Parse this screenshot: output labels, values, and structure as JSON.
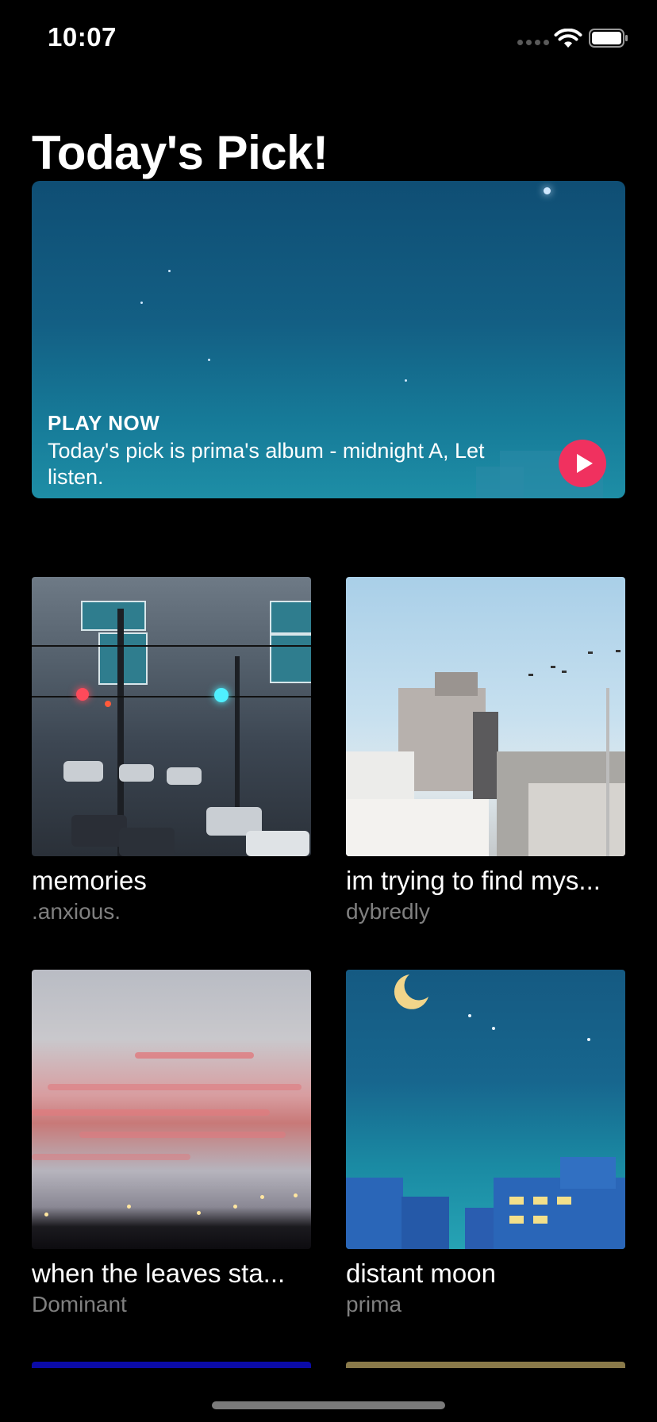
{
  "status_bar": {
    "time": "10:07"
  },
  "page": {
    "title": "Today's Pick!"
  },
  "hero": {
    "label": "PLAY NOW",
    "description": "Today's pick is prima's album - midnight A, Let listen."
  },
  "albums": [
    {
      "title": "memories",
      "artist": ".anxious."
    },
    {
      "title": "im trying to find mys...",
      "artist": "dybredly"
    },
    {
      "title": "when the leaves sta...",
      "artist": "Dominant"
    },
    {
      "title": "distant moon",
      "artist": "prima"
    }
  ],
  "colors": {
    "background": "#000000",
    "accent_play": "#f0315f",
    "secondary_text": "#808080",
    "partial_left": "#0b0ba8",
    "partial_right": "#8a7a4a"
  },
  "icons": [
    "wifi-icon",
    "battery-icon",
    "play-icon",
    "moon-icon"
  ]
}
